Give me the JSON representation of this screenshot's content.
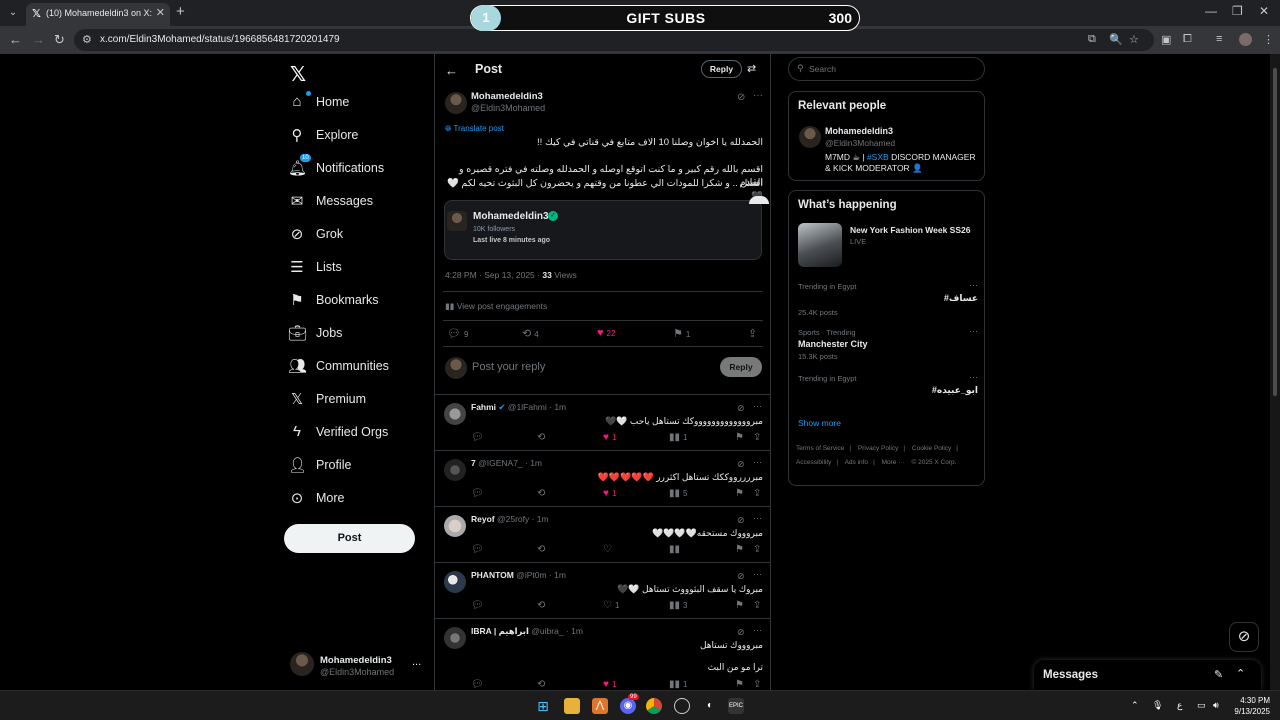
{
  "browser": {
    "tab_title": "(10) Mohamedeldin3 on X: \"الحمد",
    "url": "x.com/Eldin3Mohamed/status/1966856481720201479"
  },
  "overlay": {
    "num": "1",
    "label": "GIFT SUBS",
    "count": "300"
  },
  "nav": {
    "items": [
      {
        "label": "Home"
      },
      {
        "label": "Explore"
      },
      {
        "label": "Notifications"
      },
      {
        "label": "Messages"
      },
      {
        "label": "Grok"
      },
      {
        "label": "Lists"
      },
      {
        "label": "Bookmarks"
      },
      {
        "label": "Jobs"
      },
      {
        "label": "Communities"
      },
      {
        "label": "Premium"
      },
      {
        "label": "Verified Orgs"
      },
      {
        "label": "Profile"
      },
      {
        "label": "More"
      }
    ],
    "notif_badge": "10",
    "post_label": "Post",
    "account": {
      "name": "Mohamedeldin3",
      "handle": "@Eldin3Mohamed",
      "more": "..."
    }
  },
  "header": {
    "title": "Post",
    "reply": "Reply"
  },
  "post": {
    "name": "Mohamedeldin3",
    "handle": "@Eldin3Mohamed",
    "translate": "Translate post",
    "line1": "الحمدلله يا اخوان وصلنا 10 الاف متابع في قناتي في كيك !!",
    "line2": "اقسم بالله رقم كبير و ما كنت اتوقع اوصله و الحمدلله وصلته في فتره قصيره و القادم",
    "line3": "افضل .. و شكرا للمودات الي عطونا من وقتهم و يحضرون كل البثوث تحيه لكم 🤍🖤",
    "card": {
      "name": "Mohamedeldin3",
      "followers": "10K followers",
      "live": "Last live 8 minutes ago"
    },
    "time": "4:28 PM · Sep 13, 2025 · ",
    "views": "33",
    "views_label": "Views",
    "engagements": "View post engagements",
    "counts": {
      "replies": "9",
      "reposts": "4",
      "likes": "22",
      "bookmarks": "1"
    },
    "reply_placeholder": "Post your reply",
    "reply_button": "Reply"
  },
  "replies": [
    {
      "name": "Fahmi",
      "handle": "@1lFahmi · 1m",
      "text": "مبروووووووووووووكك تستاهل ياحب 🤍🖤",
      "likes": "1",
      "views": "1"
    },
    {
      "name": "7",
      "handle": "@IGENA7_ · 1m",
      "text": "مبررررووككك تستاهل اكثررر ❤️❤️❤️❤️❤️",
      "likes": "1",
      "views": "5"
    },
    {
      "name": "Reyof",
      "handle": "@25rofy · 1m",
      "text": "مبروووك مستحقه🤍🤍🤍🤍",
      "likes": "",
      "views": ""
    },
    {
      "name": "PHANTOM",
      "handle": "@iPt0m · 1m",
      "text": "مبروك يا سقف البثوووث تستاهل 🤍🖤",
      "likes": "1",
      "views": "3"
    },
    {
      "name": "IBRA | ابراهيم",
      "handle": "@uibra_ · 1m",
      "text": "مبروووك تستاهل",
      "text2": "ترا مو من البث",
      "likes": "1",
      "views": "1"
    }
  ],
  "right": {
    "search_placeholder": "Search",
    "relevant_title": "Relevant people",
    "person": {
      "name": "Mohamedeldin3",
      "handle": "@Eldin3Mohamed",
      "bio_pre": "M7MD ☕ | ",
      "bio_tag": "#SXB",
      "bio_post": " DISCORD MANAGER & KICK MODERATOR 👤"
    },
    "happening_title": "What’s happening",
    "event": {
      "title": "New York Fashion Week SS26",
      "status": "LIVE"
    },
    "trends": [
      {
        "ctx": "Trending in Egypt",
        "name": "#عساف",
        "posts": "25.4K posts"
      },
      {
        "ctx": "Sports · Trending",
        "name": "Manchester City",
        "posts": "15.3K posts"
      },
      {
        "ctx": "Trending in Egypt",
        "name": "#ابو_عبيده",
        "posts": ""
      }
    ],
    "show_more": "Show more",
    "footer": [
      "Terms of Service",
      "|",
      "Privacy Policy",
      "|",
      "Cookie Policy",
      "|",
      "Accessibility",
      "|",
      "Ads info",
      "|",
      "More ···",
      "© 2025 X Corp."
    ]
  },
  "messages_drawer": {
    "title": "Messages"
  },
  "taskbar": {
    "time": "4:30 PM",
    "date": "9/13/2025",
    "lang": "ع",
    "notif": "99"
  },
  "colors": {
    "accent": "#1d9bf0",
    "like": "#f91880",
    "verified": "#00ba7c"
  }
}
